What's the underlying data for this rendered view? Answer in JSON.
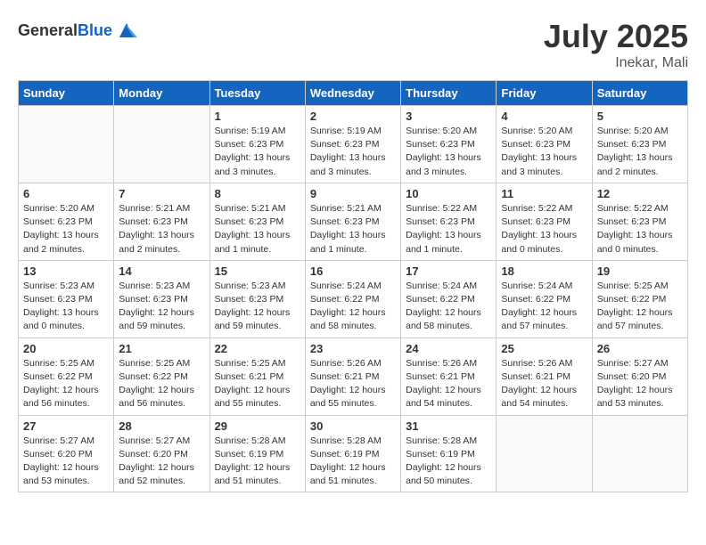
{
  "header": {
    "logo_general": "General",
    "logo_blue": "Blue",
    "month": "July 2025",
    "location": "Inekar, Mali"
  },
  "weekdays": [
    "Sunday",
    "Monday",
    "Tuesday",
    "Wednesday",
    "Thursday",
    "Friday",
    "Saturday"
  ],
  "weeks": [
    [
      {
        "day": "",
        "info": ""
      },
      {
        "day": "",
        "info": ""
      },
      {
        "day": "1",
        "info": "Sunrise: 5:19 AM\nSunset: 6:23 PM\nDaylight: 13 hours and 3 minutes."
      },
      {
        "day": "2",
        "info": "Sunrise: 5:19 AM\nSunset: 6:23 PM\nDaylight: 13 hours and 3 minutes."
      },
      {
        "day": "3",
        "info": "Sunrise: 5:20 AM\nSunset: 6:23 PM\nDaylight: 13 hours and 3 minutes."
      },
      {
        "day": "4",
        "info": "Sunrise: 5:20 AM\nSunset: 6:23 PM\nDaylight: 13 hours and 3 minutes."
      },
      {
        "day": "5",
        "info": "Sunrise: 5:20 AM\nSunset: 6:23 PM\nDaylight: 13 hours and 2 minutes."
      }
    ],
    [
      {
        "day": "6",
        "info": "Sunrise: 5:20 AM\nSunset: 6:23 PM\nDaylight: 13 hours and 2 minutes."
      },
      {
        "day": "7",
        "info": "Sunrise: 5:21 AM\nSunset: 6:23 PM\nDaylight: 13 hours and 2 minutes."
      },
      {
        "day": "8",
        "info": "Sunrise: 5:21 AM\nSunset: 6:23 PM\nDaylight: 13 hours and 1 minute."
      },
      {
        "day": "9",
        "info": "Sunrise: 5:21 AM\nSunset: 6:23 PM\nDaylight: 13 hours and 1 minute."
      },
      {
        "day": "10",
        "info": "Sunrise: 5:22 AM\nSunset: 6:23 PM\nDaylight: 13 hours and 1 minute."
      },
      {
        "day": "11",
        "info": "Sunrise: 5:22 AM\nSunset: 6:23 PM\nDaylight: 13 hours and 0 minutes."
      },
      {
        "day": "12",
        "info": "Sunrise: 5:22 AM\nSunset: 6:23 PM\nDaylight: 13 hours and 0 minutes."
      }
    ],
    [
      {
        "day": "13",
        "info": "Sunrise: 5:23 AM\nSunset: 6:23 PM\nDaylight: 13 hours and 0 minutes."
      },
      {
        "day": "14",
        "info": "Sunrise: 5:23 AM\nSunset: 6:23 PM\nDaylight: 12 hours and 59 minutes."
      },
      {
        "day": "15",
        "info": "Sunrise: 5:23 AM\nSunset: 6:23 PM\nDaylight: 12 hours and 59 minutes."
      },
      {
        "day": "16",
        "info": "Sunrise: 5:24 AM\nSunset: 6:22 PM\nDaylight: 12 hours and 58 minutes."
      },
      {
        "day": "17",
        "info": "Sunrise: 5:24 AM\nSunset: 6:22 PM\nDaylight: 12 hours and 58 minutes."
      },
      {
        "day": "18",
        "info": "Sunrise: 5:24 AM\nSunset: 6:22 PM\nDaylight: 12 hours and 57 minutes."
      },
      {
        "day": "19",
        "info": "Sunrise: 5:25 AM\nSunset: 6:22 PM\nDaylight: 12 hours and 57 minutes."
      }
    ],
    [
      {
        "day": "20",
        "info": "Sunrise: 5:25 AM\nSunset: 6:22 PM\nDaylight: 12 hours and 56 minutes."
      },
      {
        "day": "21",
        "info": "Sunrise: 5:25 AM\nSunset: 6:22 PM\nDaylight: 12 hours and 56 minutes."
      },
      {
        "day": "22",
        "info": "Sunrise: 5:25 AM\nSunset: 6:21 PM\nDaylight: 12 hours and 55 minutes."
      },
      {
        "day": "23",
        "info": "Sunrise: 5:26 AM\nSunset: 6:21 PM\nDaylight: 12 hours and 55 minutes."
      },
      {
        "day": "24",
        "info": "Sunrise: 5:26 AM\nSunset: 6:21 PM\nDaylight: 12 hours and 54 minutes."
      },
      {
        "day": "25",
        "info": "Sunrise: 5:26 AM\nSunset: 6:21 PM\nDaylight: 12 hours and 54 minutes."
      },
      {
        "day": "26",
        "info": "Sunrise: 5:27 AM\nSunset: 6:20 PM\nDaylight: 12 hours and 53 minutes."
      }
    ],
    [
      {
        "day": "27",
        "info": "Sunrise: 5:27 AM\nSunset: 6:20 PM\nDaylight: 12 hours and 53 minutes."
      },
      {
        "day": "28",
        "info": "Sunrise: 5:27 AM\nSunset: 6:20 PM\nDaylight: 12 hours and 52 minutes."
      },
      {
        "day": "29",
        "info": "Sunrise: 5:28 AM\nSunset: 6:19 PM\nDaylight: 12 hours and 51 minutes."
      },
      {
        "day": "30",
        "info": "Sunrise: 5:28 AM\nSunset: 6:19 PM\nDaylight: 12 hours and 51 minutes."
      },
      {
        "day": "31",
        "info": "Sunrise: 5:28 AM\nSunset: 6:19 PM\nDaylight: 12 hours and 50 minutes."
      },
      {
        "day": "",
        "info": ""
      },
      {
        "day": "",
        "info": ""
      }
    ]
  ]
}
